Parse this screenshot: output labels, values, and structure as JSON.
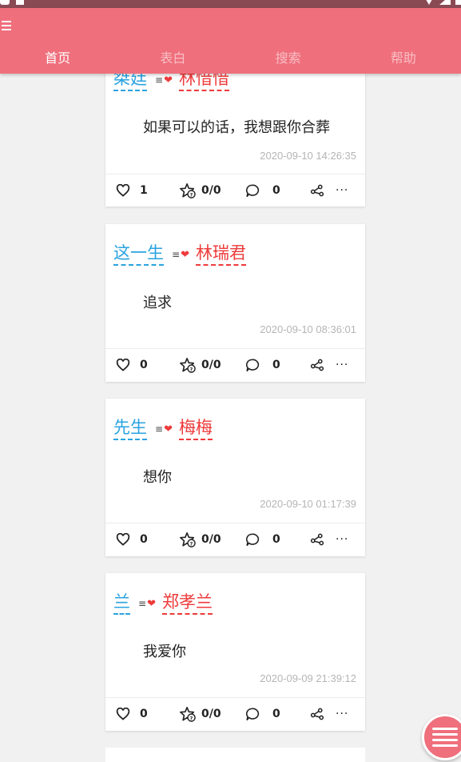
{
  "tabs": [
    {
      "label": "首页",
      "active": true
    },
    {
      "label": "表白",
      "active": false
    },
    {
      "label": "搜索",
      "active": false
    },
    {
      "label": "帮助",
      "active": false
    }
  ],
  "link_symbol": "≡",
  "heart_symbol": "❤",
  "more_symbol": "···",
  "colors": {
    "accent": "#ef6f7c",
    "name_from": "#2aa3e0",
    "name_to": "#ee3b3b",
    "timestamp": "#b5b5b5"
  },
  "posts": [
    {
      "from": "桀廷",
      "to": "林愔愔",
      "message": "如果可以的话，我想跟你合葬",
      "time": "2020-09-10 14:26:35",
      "likes": "1",
      "favs": "0/0",
      "comments": "0"
    },
    {
      "from": "这一生",
      "to": "林瑞君",
      "message": "追求",
      "time": "2020-09-10 08:36:01",
      "likes": "0",
      "favs": "0/0",
      "comments": "0"
    },
    {
      "from": "先生",
      "to": "梅梅",
      "message": "想你",
      "time": "2020-09-10 01:17:39",
      "likes": "0",
      "favs": "0/0",
      "comments": "0"
    },
    {
      "from": "兰",
      "to": "郑孝兰",
      "message": "我爱你",
      "time": "2020-09-09 21:39:12",
      "likes": "0",
      "favs": "0/0",
      "comments": "0"
    }
  ]
}
